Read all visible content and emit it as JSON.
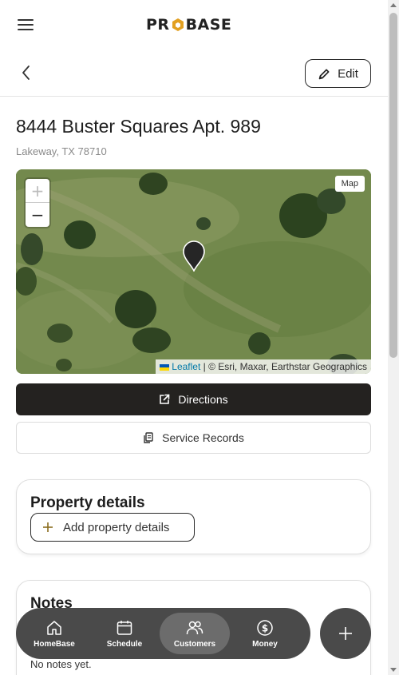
{
  "header": {
    "logo_left": "PR",
    "logo_right": "BASE",
    "logo_accent_color": "#e2a021",
    "menu_icon": "hamburger-icon"
  },
  "subheader": {
    "back_icon": "chevron-left-icon",
    "edit_label": "Edit",
    "edit_icon": "pencil-icon"
  },
  "property": {
    "address": "8444 Buster Squares Apt. 989",
    "city_line": "Lakeway, TX 78710"
  },
  "map": {
    "zoom_in": "+",
    "zoom_out": "−",
    "type_label": "Map",
    "attribution_link": "Leaflet",
    "attribution_text": " | © Esri, Maxar, Earthstar Geographics",
    "marker_icon": "map-pin-icon"
  },
  "actions": {
    "directions_label": "Directions",
    "directions_icon": "external-link-icon",
    "records_label": "Service Records",
    "records_icon": "documents-icon"
  },
  "property_details": {
    "title": "Property details",
    "add_label": "Add property details",
    "add_icon": "plus-icon",
    "add_icon_color": "#8a6d1e"
  },
  "notes": {
    "title": "Notes",
    "empty_text": "No notes yet."
  },
  "bottom_nav": {
    "items": [
      {
        "label": "HomeBase",
        "icon": "home-icon",
        "active": false
      },
      {
        "label": "Schedule",
        "icon": "calendar-icon",
        "active": false
      },
      {
        "label": "Customers",
        "icon": "users-icon",
        "active": true
      },
      {
        "label": "Money",
        "icon": "dollar-icon",
        "active": false
      }
    ],
    "fab_icon": "plus-icon"
  }
}
